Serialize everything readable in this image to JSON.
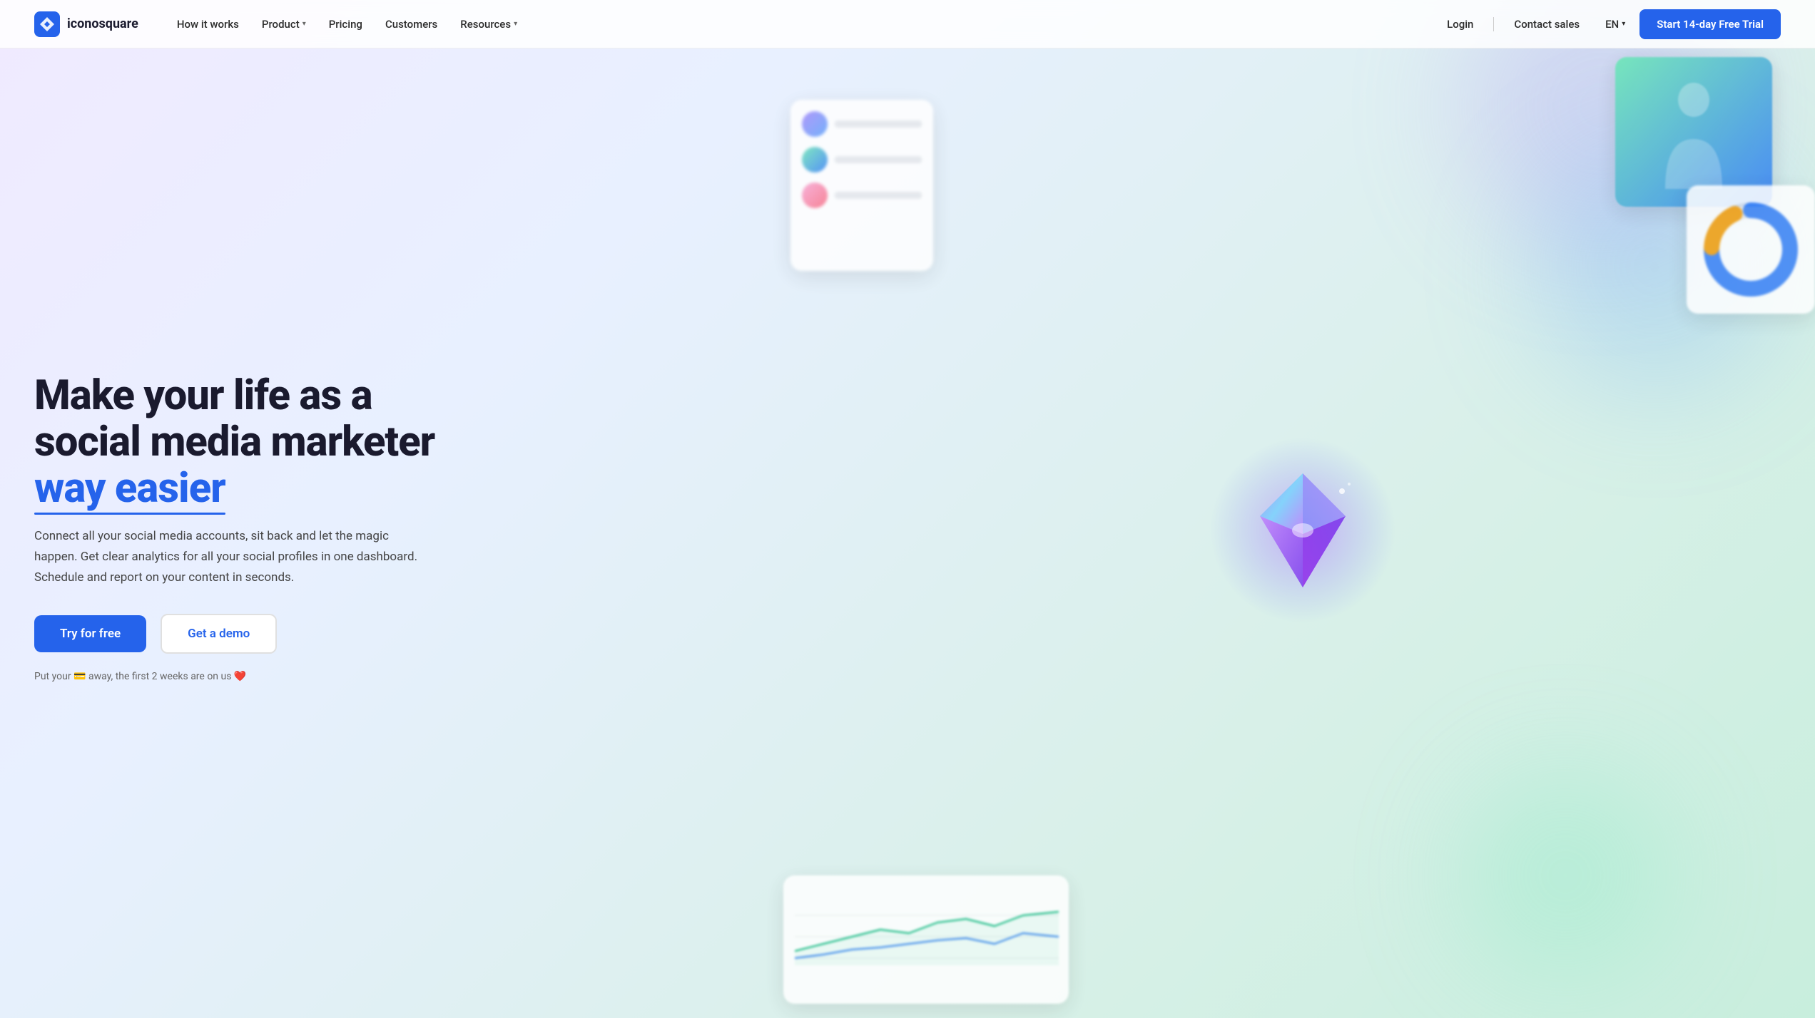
{
  "nav": {
    "logo_text": "iconosquare",
    "links": [
      {
        "label": "How it works",
        "has_chevron": false
      },
      {
        "label": "Product",
        "has_chevron": true
      },
      {
        "label": "Pricing",
        "has_chevron": false
      },
      {
        "label": "Customers",
        "has_chevron": false
      },
      {
        "label": "Resources",
        "has_chevron": true
      }
    ],
    "login_label": "Login",
    "contact_label": "Contact sales",
    "lang_label": "EN",
    "cta_label": "Start 14-day Free Trial"
  },
  "hero": {
    "title_line1": "Make your life as a",
    "title_line2": "social media marketer",
    "title_highlight": "way easier",
    "description": "Connect all your social media accounts, sit back and let the magic happen. Get clear analytics for all your social profiles in one dashboard. Schedule and report on your content in seconds.",
    "btn_primary": "Try for free",
    "btn_secondary": "Get a demo",
    "note": "Put your 💳 away, the first 2 weeks are on us ❤️"
  }
}
